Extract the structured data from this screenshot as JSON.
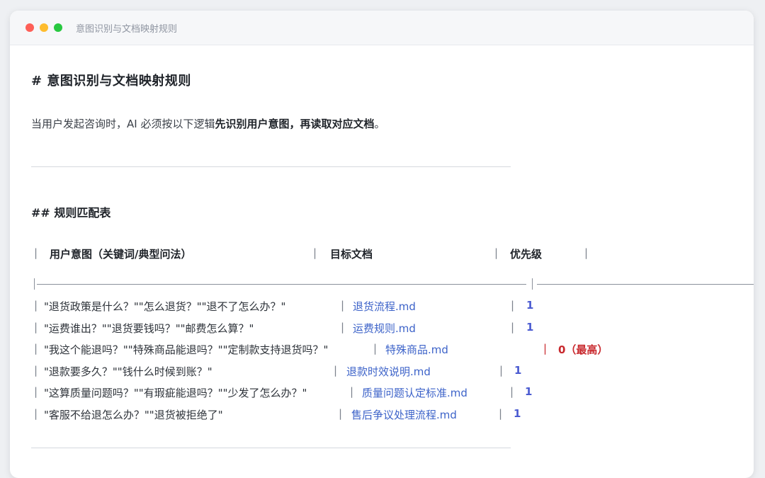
{
  "window": {
    "title": "意图识别与文档映射规则"
  },
  "doc": {
    "h1": "#  意图识别与文档映射规则",
    "para_prefix": "当用户发起咨询时，AI 必须按以下逻辑",
    "para_bold": "先识别用户意图，再读取对应文档",
    "para_suffix": "。",
    "h2": "##  规则匹配表"
  },
  "table": {
    "pipe": "|",
    "headers": [
      "用户意图（关键词/典型问法）",
      "目标文档",
      "优先级"
    ],
    "rows": [
      {
        "intent": "\"退货政策是什么？\"\"怎么退货？\"\"退不了怎么办？\"",
        "doc": "退货流程.md",
        "priority": "1"
      },
      {
        "intent": "\"运费谁出？\"\"退货要钱吗？\"\"邮费怎么算？\"",
        "doc": "运费规则.md",
        "priority": "1"
      },
      {
        "intent": "\"我这个能退吗？\"\"特殊商品能退吗？\"\"定制款支持退货吗？\"",
        "doc": "特殊商品.md",
        "priority": "0（最高）"
      },
      {
        "intent": "\"退款要多久？\"\"钱什么时候到账？\"",
        "doc": "退款时效说明.md",
        "priority": "1"
      },
      {
        "intent": "\"这算质量问题吗？\"\"有瑕疵能退吗？\"\"少发了怎么办？\"",
        "doc": "质量问题认定标准.md",
        "priority": "1"
      },
      {
        "intent": "\"客服不给退怎么办？\"\"退货被拒绝了\"",
        "doc": "售后争议处理流程.md",
        "priority": "1"
      }
    ]
  },
  "colors": {
    "doc_link": "#3d63c9",
    "priority": "#4b5bd1",
    "priority_highest": "#c8282d"
  }
}
